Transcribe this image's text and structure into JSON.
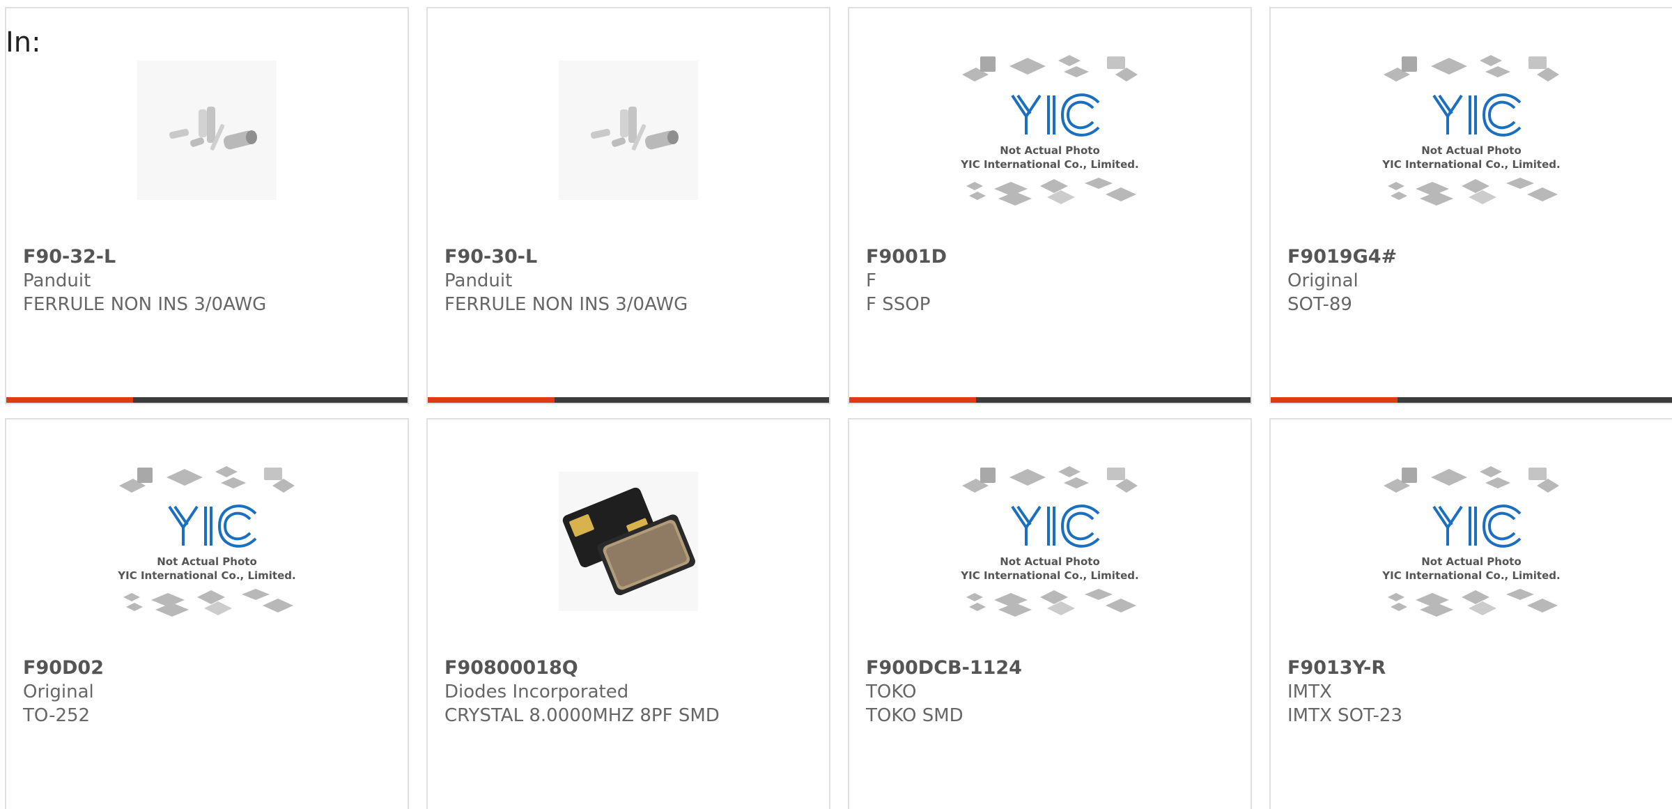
{
  "filter_label": "In:",
  "placeholder_logo": {
    "line1": "Not Actual Photo",
    "line2": "YIC International Co., Limited.",
    "brand": "YIC"
  },
  "products": [
    {
      "part": "F90-32-L",
      "maker": "Panduit",
      "desc": "FERRULE NON INS 3/0AWG",
      "image": "ferrule-photo"
    },
    {
      "part": "F90-30-L",
      "maker": "Panduit",
      "desc": "FERRULE NON INS 3/0AWG",
      "image": "ferrule-photo"
    },
    {
      "part": "F9001D",
      "maker": "F",
      "desc": "F SSOP",
      "image": "placeholder"
    },
    {
      "part": "F9019G4#",
      "maker": "Original",
      "desc": "SOT-89",
      "image": "placeholder"
    },
    {
      "part": "F90D02",
      "maker": "Original",
      "desc": "TO-252",
      "image": "placeholder"
    },
    {
      "part": "F90800018Q",
      "maker": "Diodes Incorporated",
      "desc": "CRYSTAL 8.0000MHZ 8PF SMD",
      "image": "crystal-photo"
    },
    {
      "part": "F900DCB-1124",
      "maker": "TOKO",
      "desc": "TOKO SMD",
      "image": "placeholder"
    },
    {
      "part": "F9013Y-R",
      "maker": "IMTX",
      "desc": "IMTX SOT-23",
      "image": "placeholder"
    }
  ],
  "colors": {
    "accent": "#e03a14",
    "bar": "#3c3c3c",
    "logo_blue": "#1a6fc0"
  }
}
